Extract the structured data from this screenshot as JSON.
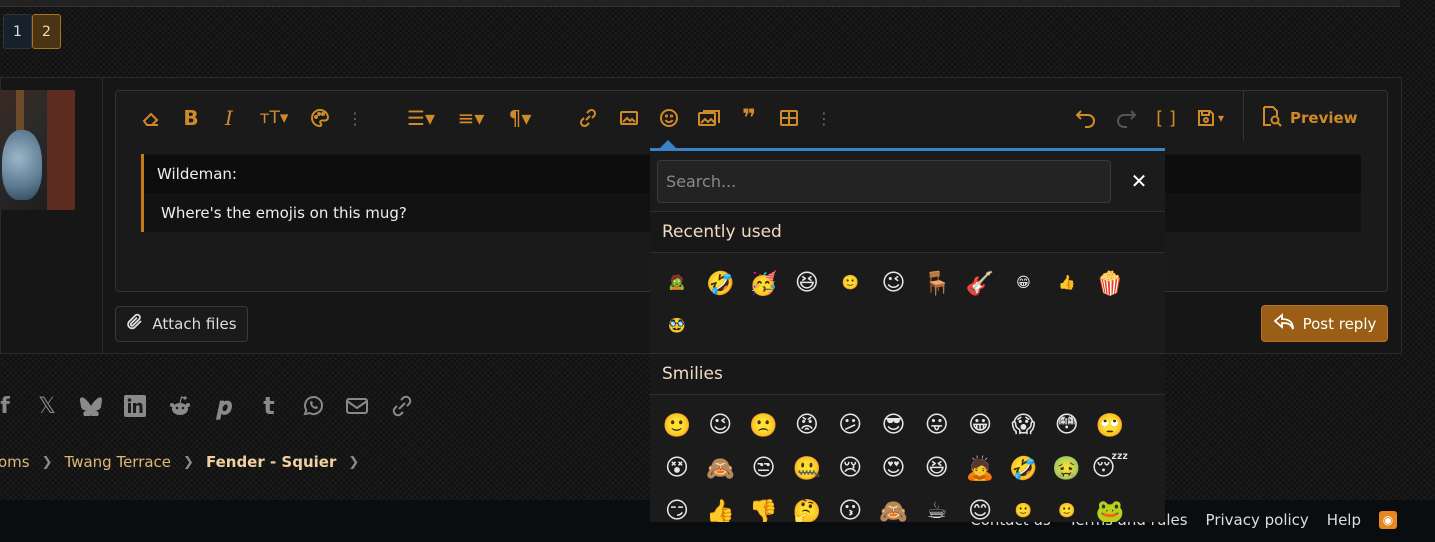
{
  "pagination": {
    "pages": [
      "1",
      "2"
    ],
    "current": "2"
  },
  "editor": {
    "preview_label": "Preview",
    "quote": {
      "author": "Wildeman:",
      "text": "Where's the emojis on this mug?"
    },
    "attach_label": "Attach files",
    "post_label": "Post reply"
  },
  "toolbar": {
    "left": [
      "eraser-icon",
      "bold-icon",
      "italic-icon",
      "text-size-icon",
      "palette-icon",
      "more-vertical-icon",
      "list-icon",
      "align-icon",
      "paragraph-icon",
      "link-icon",
      "image-icon",
      "smiley-icon",
      "media-icon",
      "quote-icon",
      "table-icon",
      "more-vertical-icon"
    ],
    "right": [
      "undo-icon",
      "redo-icon",
      "bbcode-icon",
      "drafts-icon"
    ]
  },
  "emoji_picker": {
    "search_placeholder": "Search...",
    "recent_title": "Recently used",
    "smilies_title": "Smilies",
    "recent": [
      "🧟",
      "🤣",
      "🥳",
      "😆",
      "🙂",
      "😉",
      "🪑",
      "🎸",
      "😁",
      "👍",
      "🍿",
      "🥸"
    ],
    "smilies": [
      "🙂",
      "😉",
      "🙁",
      "😡",
      "😕",
      "😎",
      "😛",
      "😀",
      "😱",
      "😳",
      "🙄",
      "😵",
      "🙈",
      "😒",
      "🤐",
      "😢",
      "😍",
      "😆",
      "🙇",
      "🤣",
      "🤢",
      "😴",
      "😏",
      "👍",
      "👎",
      "🤔",
      "😗",
      "🙈",
      "☕",
      "😊",
      "🙂",
      "🙂",
      "🐸"
    ]
  },
  "share_icons": [
    "facebook-icon",
    "x-icon",
    "bluesky-icon",
    "linkedin-icon",
    "reddit-icon",
    "pinterest-icon",
    "tumblr-icon",
    "whatsapp-icon",
    "email-icon",
    "link-icon"
  ],
  "breadcrumb": {
    "items": [
      "oms",
      "Twang Terrace",
      "Fender - Squier"
    ]
  },
  "footer": {
    "links": [
      "Contact us",
      "Terms and rules",
      "Privacy policy",
      "Help"
    ]
  },
  "colors": {
    "accent": "#d08a2a",
    "popup_border": "#3a83c4",
    "post_button": "#9a5e16"
  }
}
